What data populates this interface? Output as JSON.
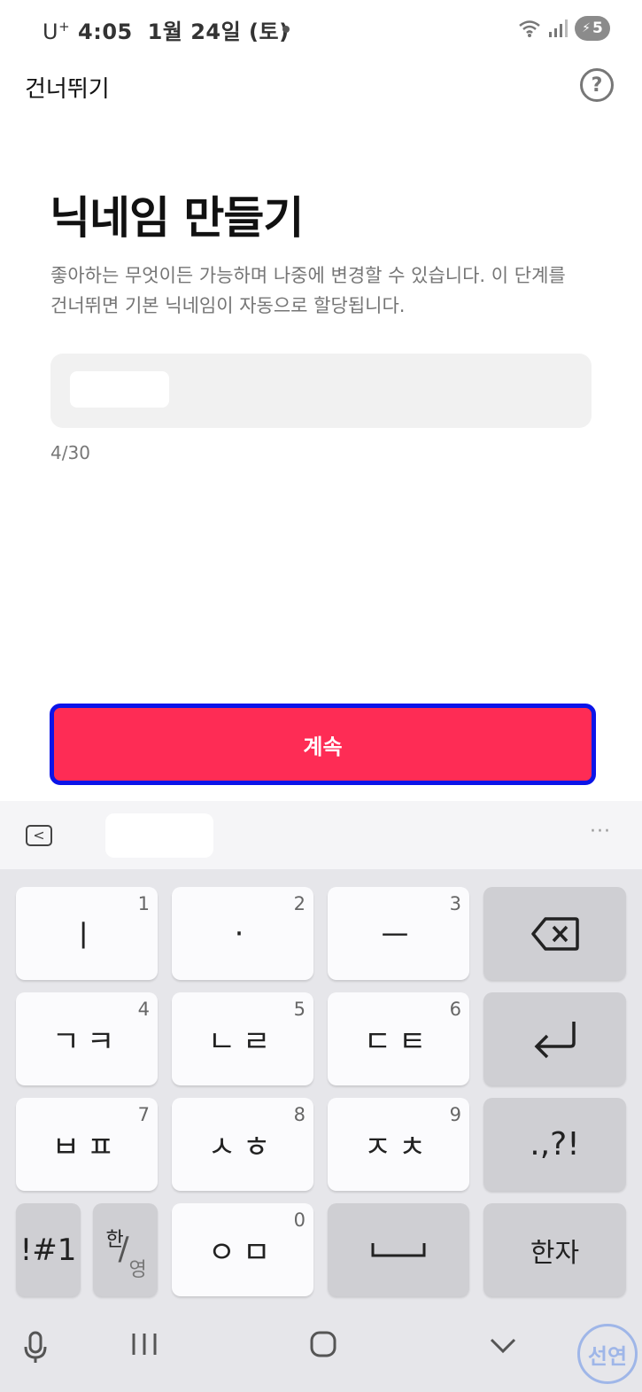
{
  "status_bar": {
    "carrier": "U",
    "carrier_sup": "+",
    "time": "4:05",
    "date": "1월 24일 (토)",
    "battery": "5"
  },
  "header": {
    "skip_label": "건너뛰기",
    "help_label": "?"
  },
  "main": {
    "title": "닉네임 만들기",
    "description": "좋아하는 무엇이든 가능하며 나중에 변경할 수 있습니다. 이 단계를 건너뛰면 기본 닉네임이 자동으로 할당됩니다.",
    "char_counter": "4/30",
    "continue_label": "계속"
  },
  "keyboard": {
    "toolbar": {
      "back_label": "<",
      "more_label": "···"
    },
    "keys": [
      {
        "main": "ㅣ",
        "num": "1"
      },
      {
        "main": "·",
        "num": "2"
      },
      {
        "main": "ㅡ",
        "num": "3"
      },
      {
        "main": "ㄱㅋ",
        "num": "4"
      },
      {
        "main": "ㄴㄹ",
        "num": "5"
      },
      {
        "main": "ㄷㅌ",
        "num": "6"
      },
      {
        "main": "ㅂㅍ",
        "num": "7"
      },
      {
        "main": "ㅅㅎ",
        "num": "8"
      },
      {
        "main": "ㅈㅊ",
        "num": "9"
      },
      {
        "main": "ㅇㅁ",
        "num": "0"
      }
    ],
    "punct_label": ".,?!",
    "symbols_label": "!#1",
    "lang_han": "한",
    "lang_slash": "/",
    "lang_eng": "영",
    "hanja_label": "한자",
    "backspace_icon": "⌫",
    "enter_icon": "↵",
    "space_icon": "␣"
  },
  "nav_bar": {
    "mic_icon": "mic-icon",
    "recents_icon": "|||",
    "home_icon": "○",
    "hide_icon": "∨"
  },
  "watermark": "선연",
  "colors": {
    "accent": "#fe2c55",
    "highlight_border": "#0b14e8"
  }
}
